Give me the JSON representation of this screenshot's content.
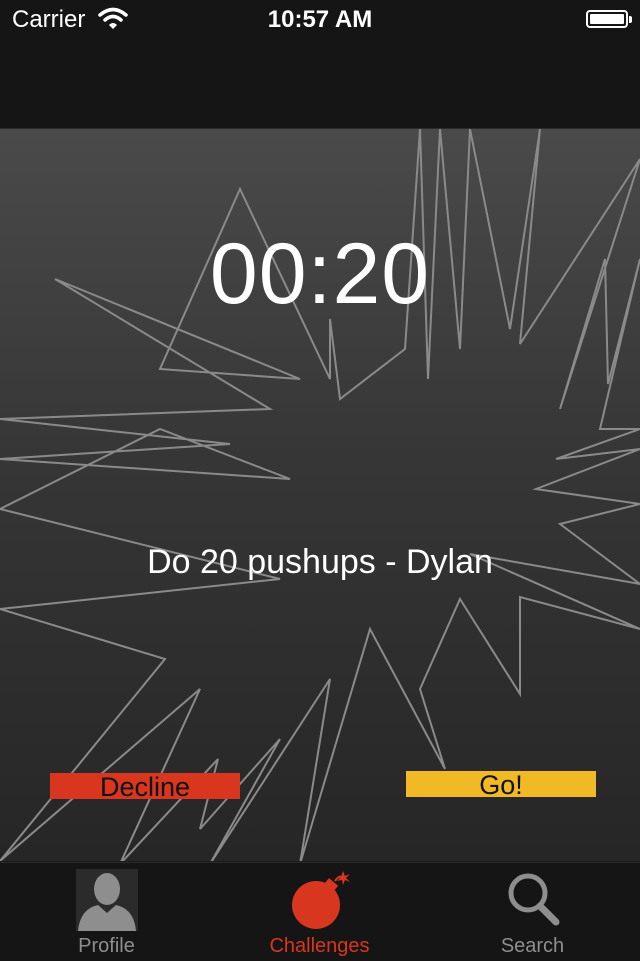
{
  "status_bar": {
    "carrier": "Carrier",
    "time": "10:57 AM",
    "battery_level": 1.0
  },
  "challenge": {
    "timer": "00:20",
    "text": "Do 20 pushups - Dylan",
    "decline_label": "Decline",
    "go_label": "Go!"
  },
  "tab_bar": {
    "active": "Challenges",
    "tabs": [
      {
        "label": "Profile",
        "icon": "person-silhouette-icon"
      },
      {
        "label": "Challenges",
        "icon": "bomb-icon"
      },
      {
        "label": "Search",
        "icon": "magnifier-icon"
      }
    ]
  },
  "colors": {
    "accent_red": "#d9361f",
    "accent_yellow": "#f2b927",
    "background": "#2e2e2e",
    "bar_background": "#151515"
  }
}
